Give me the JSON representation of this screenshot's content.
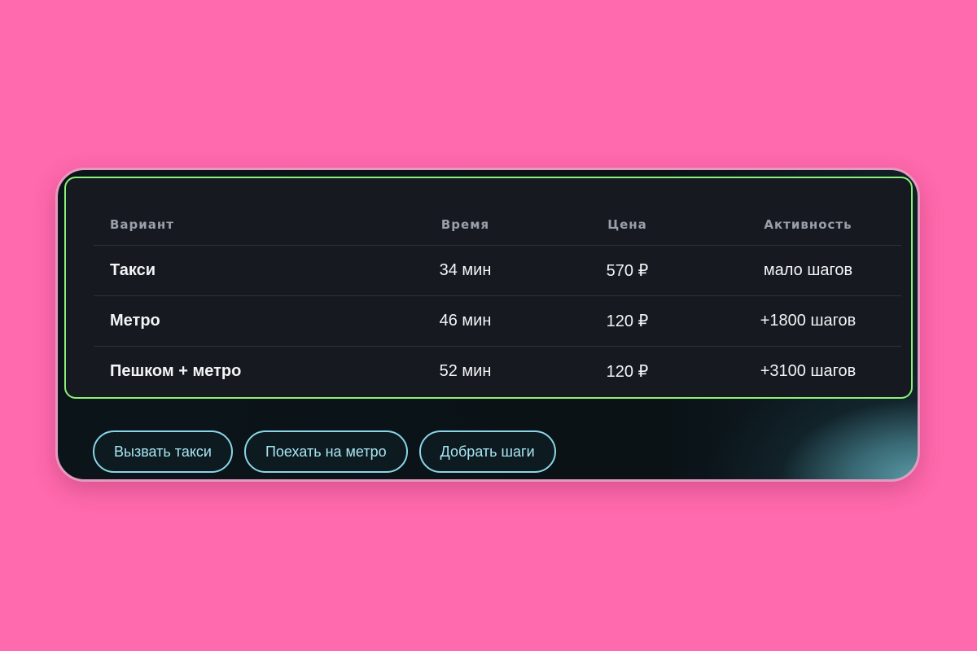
{
  "table": {
    "headers": [
      "Вариант",
      "Время",
      "Цена",
      "Активность"
    ],
    "rows": [
      {
        "option": "Такси",
        "time": "34 мин",
        "price": "570 ₽",
        "activity": "мало шагов"
      },
      {
        "option": "Метро",
        "time": "46 мин",
        "price": "120 ₽",
        "activity": "+1800 шагов"
      },
      {
        "option": "Пешком + метро",
        "time": "52 мин",
        "price": "120 ₽",
        "activity": "+3100 шагов"
      }
    ]
  },
  "actions": {
    "taxi": "Вызвать такси",
    "metro": "Поехать на метро",
    "steps": "Добрать шаги"
  },
  "colors": {
    "background": "#ff69ad",
    "panel_border": "#8ef07a",
    "button_border": "#8ad6e8"
  }
}
